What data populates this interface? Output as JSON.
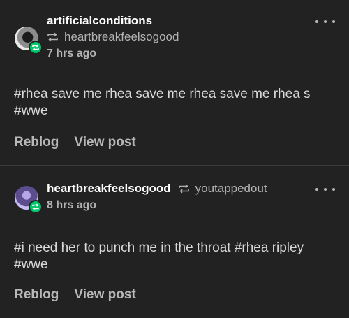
{
  "colors": {
    "background": "#222222",
    "reblog_badge": "#00c46a",
    "muted": "#b3b3b3"
  },
  "posts": [
    {
      "author": "artificialconditions",
      "reblogged_from": "heartbreakfeelsogood",
      "time": "7 hrs ago",
      "body": "#rhea save me rhea save me rhea save me rhea s #wwe",
      "actions": {
        "reblog": "Reblog",
        "view": "View post"
      }
    },
    {
      "author": "heartbreakfeelsogood",
      "reblogged_from": "youtappedout",
      "time": "8 hrs ago",
      "body": "#i need her to punch me in the throat  #rhea ripley  #wwe",
      "actions": {
        "reblog": "Reblog",
        "view": "View post"
      }
    }
  ],
  "icons": {
    "more": "more-dots-icon",
    "reblog": "reblog-icon"
  }
}
